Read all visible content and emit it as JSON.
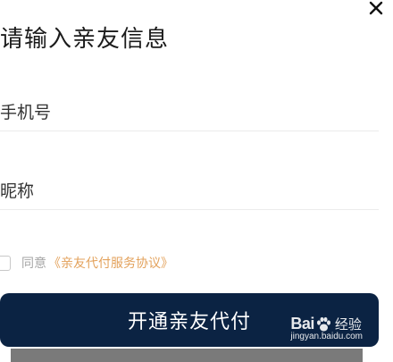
{
  "dialog": {
    "title": "请输入亲友信息",
    "phone_placeholder": "手机号",
    "nickname_placeholder": "昵称",
    "agree_text": "同意",
    "agreement_link": "《亲友代付服务协议》",
    "submit_label": "开通亲友代付"
  },
  "watermark": {
    "logo_left": "Bai",
    "logo_right": "经验",
    "url": "jingyan.baidu.com"
  },
  "colors": {
    "button_bg": "#0b2343",
    "link": "#e3a25c"
  }
}
